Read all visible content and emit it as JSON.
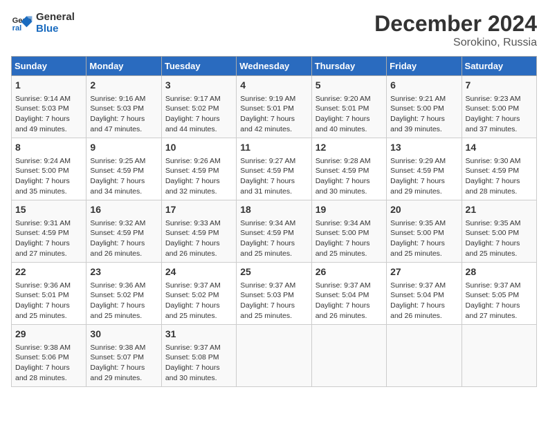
{
  "logo": {
    "line1": "General",
    "line2": "Blue"
  },
  "title": "December 2024",
  "subtitle": "Sorokino, Russia",
  "days_of_week": [
    "Sunday",
    "Monday",
    "Tuesday",
    "Wednesday",
    "Thursday",
    "Friday",
    "Saturday"
  ],
  "weeks": [
    [
      {
        "day": "1",
        "sunrise": "9:14 AM",
        "sunset": "5:03 PM",
        "daylight": "7 hours and 49 minutes."
      },
      {
        "day": "2",
        "sunrise": "9:16 AM",
        "sunset": "5:03 PM",
        "daylight": "7 hours and 47 minutes."
      },
      {
        "day": "3",
        "sunrise": "9:17 AM",
        "sunset": "5:02 PM",
        "daylight": "7 hours and 44 minutes."
      },
      {
        "day": "4",
        "sunrise": "9:19 AM",
        "sunset": "5:01 PM",
        "daylight": "7 hours and 42 minutes."
      },
      {
        "day": "5",
        "sunrise": "9:20 AM",
        "sunset": "5:01 PM",
        "daylight": "7 hours and 40 minutes."
      },
      {
        "day": "6",
        "sunrise": "9:21 AM",
        "sunset": "5:00 PM",
        "daylight": "7 hours and 39 minutes."
      },
      {
        "day": "7",
        "sunrise": "9:23 AM",
        "sunset": "5:00 PM",
        "daylight": "7 hours and 37 minutes."
      }
    ],
    [
      {
        "day": "8",
        "sunrise": "9:24 AM",
        "sunset": "5:00 PM",
        "daylight": "7 hours and 35 minutes."
      },
      {
        "day": "9",
        "sunrise": "9:25 AM",
        "sunset": "4:59 PM",
        "daylight": "7 hours and 34 minutes."
      },
      {
        "day": "10",
        "sunrise": "9:26 AM",
        "sunset": "4:59 PM",
        "daylight": "7 hours and 32 minutes."
      },
      {
        "day": "11",
        "sunrise": "9:27 AM",
        "sunset": "4:59 PM",
        "daylight": "7 hours and 31 minutes."
      },
      {
        "day": "12",
        "sunrise": "9:28 AM",
        "sunset": "4:59 PM",
        "daylight": "7 hours and 30 minutes."
      },
      {
        "day": "13",
        "sunrise": "9:29 AM",
        "sunset": "4:59 PM",
        "daylight": "7 hours and 29 minutes."
      },
      {
        "day": "14",
        "sunrise": "9:30 AM",
        "sunset": "4:59 PM",
        "daylight": "7 hours and 28 minutes."
      }
    ],
    [
      {
        "day": "15",
        "sunrise": "9:31 AM",
        "sunset": "4:59 PM",
        "daylight": "7 hours and 27 minutes."
      },
      {
        "day": "16",
        "sunrise": "9:32 AM",
        "sunset": "4:59 PM",
        "daylight": "7 hours and 26 minutes."
      },
      {
        "day": "17",
        "sunrise": "9:33 AM",
        "sunset": "4:59 PM",
        "daylight": "7 hours and 26 minutes."
      },
      {
        "day": "18",
        "sunrise": "9:34 AM",
        "sunset": "4:59 PM",
        "daylight": "7 hours and 25 minutes."
      },
      {
        "day": "19",
        "sunrise": "9:34 AM",
        "sunset": "5:00 PM",
        "daylight": "7 hours and 25 minutes."
      },
      {
        "day": "20",
        "sunrise": "9:35 AM",
        "sunset": "5:00 PM",
        "daylight": "7 hours and 25 minutes."
      },
      {
        "day": "21",
        "sunrise": "9:35 AM",
        "sunset": "5:00 PM",
        "daylight": "7 hours and 25 minutes."
      }
    ],
    [
      {
        "day": "22",
        "sunrise": "9:36 AM",
        "sunset": "5:01 PM",
        "daylight": "7 hours and 25 minutes."
      },
      {
        "day": "23",
        "sunrise": "9:36 AM",
        "sunset": "5:02 PM",
        "daylight": "7 hours and 25 minutes."
      },
      {
        "day": "24",
        "sunrise": "9:37 AM",
        "sunset": "5:02 PM",
        "daylight": "7 hours and 25 minutes."
      },
      {
        "day": "25",
        "sunrise": "9:37 AM",
        "sunset": "5:03 PM",
        "daylight": "7 hours and 25 minutes."
      },
      {
        "day": "26",
        "sunrise": "9:37 AM",
        "sunset": "5:04 PM",
        "daylight": "7 hours and 26 minutes."
      },
      {
        "day": "27",
        "sunrise": "9:37 AM",
        "sunset": "5:04 PM",
        "daylight": "7 hours and 26 minutes."
      },
      {
        "day": "28",
        "sunrise": "9:37 AM",
        "sunset": "5:05 PM",
        "daylight": "7 hours and 27 minutes."
      }
    ],
    [
      {
        "day": "29",
        "sunrise": "9:38 AM",
        "sunset": "5:06 PM",
        "daylight": "7 hours and 28 minutes."
      },
      {
        "day": "30",
        "sunrise": "9:38 AM",
        "sunset": "5:07 PM",
        "daylight": "7 hours and 29 minutes."
      },
      {
        "day": "31",
        "sunrise": "9:37 AM",
        "sunset": "5:08 PM",
        "daylight": "7 hours and 30 minutes."
      },
      null,
      null,
      null,
      null
    ]
  ]
}
